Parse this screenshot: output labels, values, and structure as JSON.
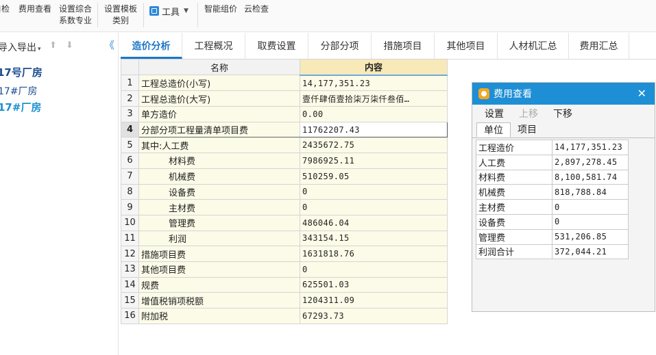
{
  "toolbar": {
    "items": [
      {
        "label": "自检"
      },
      {
        "label": "费用查看"
      },
      {
        "label_line1": "设置综合",
        "label_line2": "系数专业"
      },
      {
        "label_line1": "设置模板",
        "label_line2": "类别"
      },
      {
        "label": "工具"
      },
      {
        "label": "智能组价"
      },
      {
        "label": "云检查"
      }
    ]
  },
  "left_panel": {
    "import_export": "导入导出",
    "tree": [
      "17号厂房",
      "17#厂房",
      "17#厂房"
    ]
  },
  "tabs": [
    "造价分析",
    "工程概况",
    "取费设置",
    "分部分项",
    "措施项目",
    "其他项目",
    "人材机汇总",
    "费用汇总"
  ],
  "active_tab": "造价分析",
  "grid": {
    "headers": [
      "名称",
      "内容"
    ],
    "rows": [
      {
        "index": "1",
        "name": "工程总造价(小写)",
        "value": "14,177,351.23"
      },
      {
        "index": "2",
        "name": "工程总造价(大写)",
        "value": "壹仟肆佰壹拾柒万柒仟叁佰…"
      },
      {
        "index": "3",
        "name": "单方造价",
        "value": "0.00"
      },
      {
        "index": "4",
        "name": "分部分项工程量清单项目费",
        "value": "11762207.43"
      },
      {
        "index": "5",
        "name": "其中:人工费",
        "value": "2435672.75"
      },
      {
        "index": "6",
        "name": "材料费",
        "value": "7986925.11"
      },
      {
        "index": "7",
        "name": "机械费",
        "value": "510259.05"
      },
      {
        "index": "8",
        "name": "设备费",
        "value": "0"
      },
      {
        "index": "9",
        "name": "主材费",
        "value": "0"
      },
      {
        "index": "10",
        "name": "管理费",
        "value": "486046.04"
      },
      {
        "index": "11",
        "name": "利润",
        "value": "343154.15"
      },
      {
        "index": "12",
        "name": "措施项目费",
        "value": "1631818.76"
      },
      {
        "index": "13",
        "name": "其他项目费",
        "value": "0"
      },
      {
        "index": "14",
        "name": "规费",
        "value": "625501.03"
      },
      {
        "index": "15",
        "name": "增值税销项税额",
        "value": "1204311.09"
      },
      {
        "index": "16",
        "name": "附加税",
        "value": "67293.73"
      }
    ]
  },
  "fee_panel": {
    "title": "费用查看",
    "menu": [
      "设置",
      "上移",
      "下移"
    ],
    "subtabs": [
      "单位",
      "项目"
    ],
    "rows": [
      {
        "label": "工程造价",
        "value": "14,177,351.23"
      },
      {
        "label": "人工费",
        "value": "2,897,278.45"
      },
      {
        "label": "材料费",
        "value": "8,100,581.74"
      },
      {
        "label": "机械费",
        "value": "818,788.84"
      },
      {
        "label": "主材费",
        "value": "0"
      },
      {
        "label": "设备费",
        "value": "0"
      },
      {
        "label": "管理费",
        "value": "531,206.85"
      },
      {
        "label": "利润合计",
        "value": "372,044.21"
      }
    ]
  }
}
